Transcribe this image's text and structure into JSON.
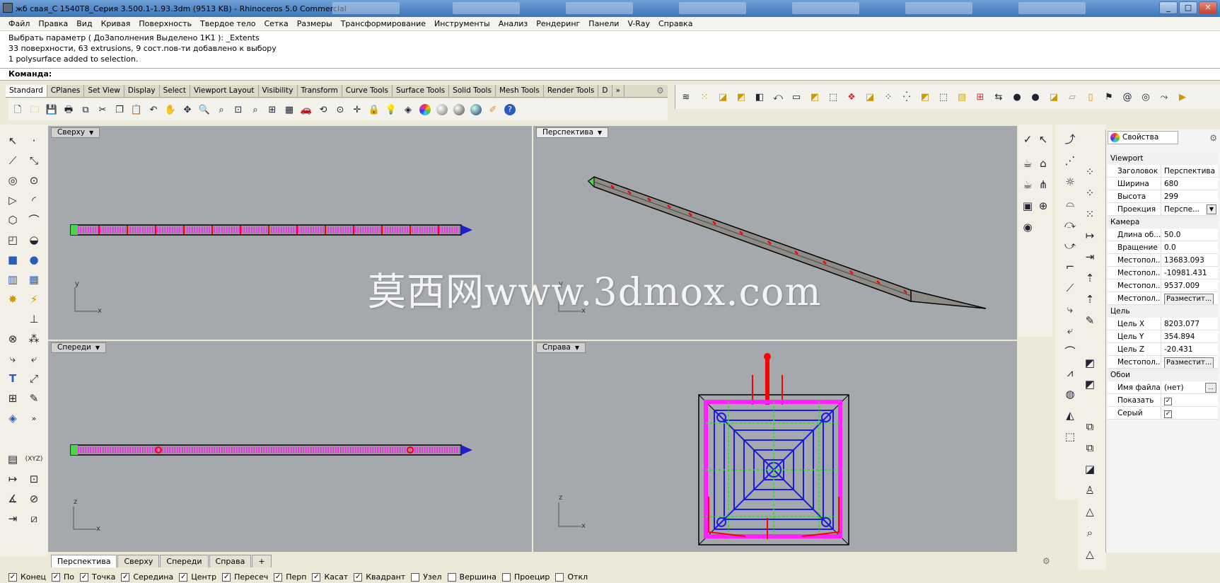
{
  "window": {
    "title": "жб свая_С 1540Т8_Серия 3.500.1-1.93.3dm (9513 KB) - Rhinoceros 5.0 Commercial",
    "minimize": "_",
    "maximize": "□",
    "close": "✕"
  },
  "menu": [
    "Файл",
    "Правка",
    "Вид",
    "Кривая",
    "Поверхность",
    "Твердое тело",
    "Сетка",
    "Размеры",
    "Трансформирование",
    "Инструменты",
    "Анализ",
    "Рендеринг",
    "Панели",
    "V-Ray",
    "Справка"
  ],
  "command_history": [
    "Выбрать параметр ( ДоЗаполнения  Выделено  1К1 ): _Extents",
    "33 поверхности, 63 extrusions, 9 сост.пов-ти добавлено к выбору",
    "1 polysurface added to selection."
  ],
  "command_prompt": "Команда:",
  "toolbar_tabs": [
    "Standard",
    "CPlanes",
    "Set View",
    "Display",
    "Select",
    "Viewport Layout",
    "Visibility",
    "Transform",
    "Curve Tools",
    "Surface Tools",
    "Solid Tools",
    "Mesh Tools",
    "Render Tools",
    "D"
  ],
  "toolbar_tabs_more": "»",
  "standard_icons": [
    "new-icon",
    "open-icon",
    "save-icon",
    "print-icon",
    "import-icon",
    "cut-icon",
    "copy-icon",
    "paste-icon",
    "undo-icon",
    "pan-icon",
    "rotate-view-icon",
    "zoom-icon",
    "zoom-window-icon",
    "zoom-extents-icon",
    "zoom-selected-icon",
    "zoom-all-icon",
    "four-viewports-icon",
    "car-icon",
    "rotate-icon",
    "grid-icon",
    "move-icon",
    "lock-icon",
    "light-icon",
    "layer-icon",
    "color-wheel-icon",
    "material-sphere-icon",
    "shade-icon",
    "render-sphere-icon",
    "options-icon",
    "help-icon"
  ],
  "viewports": {
    "top": {
      "label": "Сверху",
      "axes": [
        "y",
        "x"
      ]
    },
    "perspective": {
      "label": "Перспектива",
      "axes": [
        "y",
        "x"
      ]
    },
    "front": {
      "label": "Спереди",
      "axes": [
        "z",
        "x"
      ]
    },
    "right": {
      "label": "Справа",
      "axes": [
        "z",
        "x"
      ]
    }
  },
  "watermark": "莫西网www.3dmox.com",
  "bottom_tabs": [
    "Перспектива",
    "Сверху",
    "Спереди",
    "Справа"
  ],
  "add_tab": "+",
  "osnaps": [
    {
      "label": "Конец",
      "checked": true
    },
    {
      "label": "По",
      "checked": true
    },
    {
      "label": "Точка",
      "checked": true
    },
    {
      "label": "Середина",
      "checked": true
    },
    {
      "label": "Центр",
      "checked": true
    },
    {
      "label": "Пересеч",
      "checked": true
    },
    {
      "label": "Перп",
      "checked": true
    },
    {
      "label": "Касат",
      "checked": true
    },
    {
      "label": "Квадрант",
      "checked": true
    },
    {
      "label": "Узел",
      "checked": false
    },
    {
      "label": "Вершина",
      "checked": false
    },
    {
      "label": "Проецир",
      "checked": false
    },
    {
      "label": "Откл",
      "checked": false
    }
  ],
  "properties": {
    "tab": "Свойства",
    "section_viewport": "Viewport",
    "title_k": "Заголовок",
    "title_v": "Перспектива",
    "width_k": "Ширина",
    "width_v": "680",
    "height_k": "Высота",
    "height_v": "299",
    "proj_k": "Проекция",
    "proj_v": "Перспе...",
    "section_camera": "Камера",
    "lens_k": "Длина об...",
    "lens_v": "50.0",
    "rot_k": "Вращение",
    "rot_v": "0.0",
    "locx_k": "Местопол...",
    "locx_v": "13683.093",
    "locy_k": "Местопол...",
    "locy_v": "-10981.431",
    "locz_k": "Местопол...",
    "locz_v": "9537.009",
    "loc_k": "Местопол...",
    "loc_btn": "Разместит...",
    "section_target": "Цель",
    "tx_k": "Цель X",
    "tx_v": "8203.077",
    "ty_k": "Цель Y",
    "ty_v": "354.894",
    "tz_k": "Цель Z",
    "tz_v": "-20.431",
    "tloc_k": "Местопол...",
    "tloc_btn": "Разместит...",
    "section_wallpaper": "Обои",
    "file_k": "Имя файла",
    "file_v": "(нет)",
    "file_btn": "...",
    "show_k": "Показать",
    "show_v": true,
    "gray_k": "Серый",
    "gray_v": true
  },
  "left_toolbar_more": "»",
  "xyz_label": "(XYZ)"
}
